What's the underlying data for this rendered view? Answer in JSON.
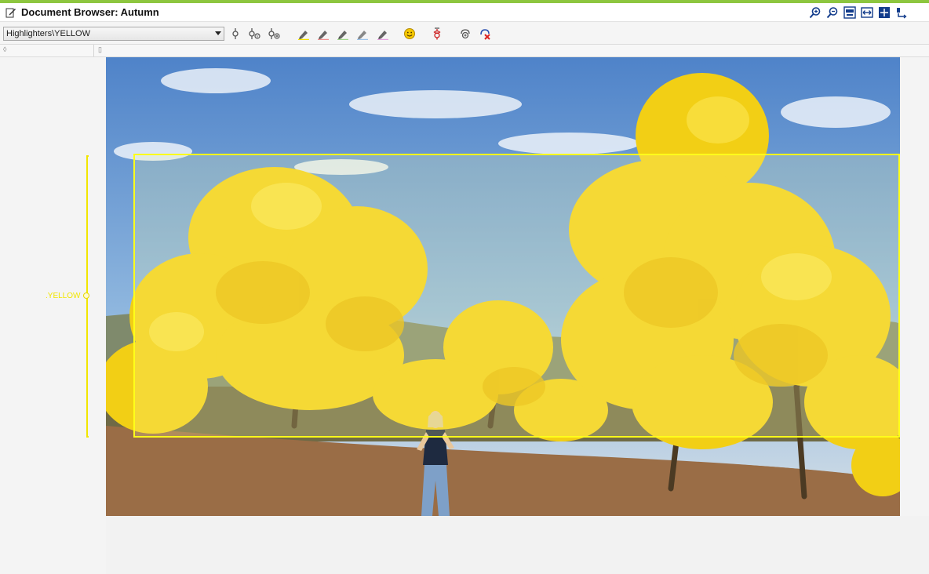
{
  "window": {
    "title": "Document Browser: Autumn",
    "accent_color": "#8dc63f"
  },
  "title_tools": [
    "zoom-in-icon",
    "zoom-out-icon",
    "zoom-100-icon",
    "fit-width-icon",
    "fit-page-icon",
    "sync-icon"
  ],
  "toolbar": {
    "highlighter_select": "Highlighters\\YELLOW",
    "tools": [
      "code-icon",
      "code-in-vivo-icon",
      "code-with-new-icon",
      "highlighter-yellow-icon",
      "highlighter-red-icon",
      "highlighter-green-icon",
      "highlighter-blue-icon",
      "highlighter-magenta-icon",
      "emoticon-icon",
      "symbol-icon",
      "memo-icon",
      "remove-code-icon"
    ]
  },
  "code": {
    "label": ".YELLOW",
    "color": "#f2e600"
  },
  "highlight": {
    "color": "#ffff1a"
  }
}
